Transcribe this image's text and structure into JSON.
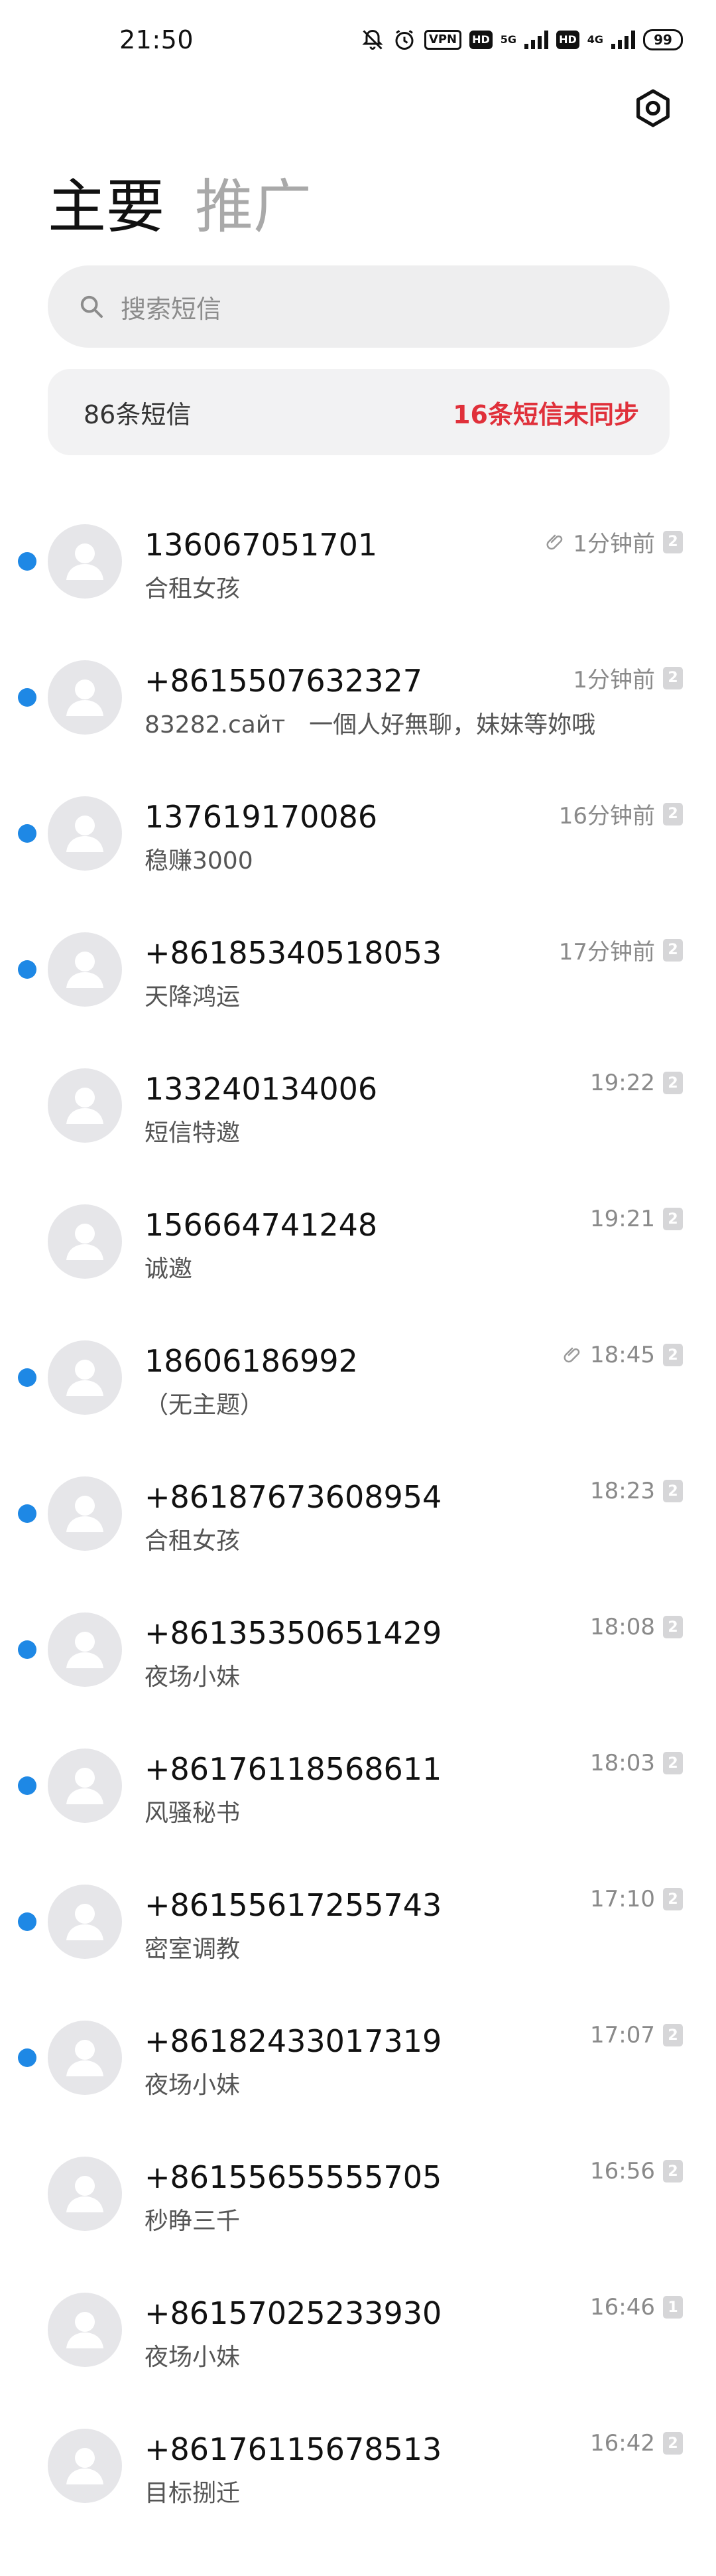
{
  "status_bar": {
    "time": "21:50",
    "vpn_label": "VPN",
    "hd_label_1": "HD",
    "net_1": "5G",
    "hd_label_2": "HD",
    "net_2": "4G",
    "battery": "99"
  },
  "tabs": [
    {
      "label": "主要",
      "active": true
    },
    {
      "label": "推广",
      "active": false
    }
  ],
  "search": {
    "placeholder": "搜索短信"
  },
  "summary": {
    "count_text": "86条短信",
    "unsynced_text": "16条短信未同步"
  },
  "colors": {
    "unread_dot": "#1e88e5",
    "unsynced": "#e0303a"
  },
  "messages": [
    {
      "sender": "136067051701",
      "preview": "合租女孩",
      "time": "1分钟前",
      "sim": "2",
      "unread": true,
      "attachment": true
    },
    {
      "sender": "+8615507632327",
      "preview": "83282.сайт　一個人好無聊，妹妹等妳哦",
      "time": "1分钟前",
      "sim": "2",
      "unread": true,
      "attachment": false
    },
    {
      "sender": "137619170086",
      "preview": "稳赚3000",
      "time": "16分钟前",
      "sim": "2",
      "unread": true,
      "attachment": false
    },
    {
      "sender": "+86185340518053",
      "preview": "天降鸿运",
      "time": "17分钟前",
      "sim": "2",
      "unread": true,
      "attachment": false
    },
    {
      "sender": "133240134006",
      "preview": "短信特邀",
      "time": "19:22",
      "sim": "2",
      "unread": false,
      "attachment": false
    },
    {
      "sender": "156664741248",
      "preview": "诚邀",
      "time": "19:21",
      "sim": "2",
      "unread": false,
      "attachment": false
    },
    {
      "sender": "18606186992",
      "preview": "（无主题）",
      "time": "18:45",
      "sim": "2",
      "unread": true,
      "attachment": true
    },
    {
      "sender": "+86187673608954",
      "preview": "合租女孩",
      "time": "18:23",
      "sim": "2",
      "unread": true,
      "attachment": false
    },
    {
      "sender": "+86135350651429",
      "preview": "夜场小妹",
      "time": "18:08",
      "sim": "2",
      "unread": true,
      "attachment": false
    },
    {
      "sender": "+86176118568611",
      "preview": "风骚秘书",
      "time": "18:03",
      "sim": "2",
      "unread": true,
      "attachment": false
    },
    {
      "sender": "+86155617255743",
      "preview": "密室调教",
      "time": "17:10",
      "sim": "2",
      "unread": true,
      "attachment": false
    },
    {
      "sender": "+86182433017319",
      "preview": "夜场小妹",
      "time": "17:07",
      "sim": "2",
      "unread": true,
      "attachment": false
    },
    {
      "sender": "+86155655555705",
      "preview": "秒睁三千",
      "time": "16:56",
      "sim": "2",
      "unread": false,
      "attachment": false
    },
    {
      "sender": "+86157025233930",
      "preview": "夜场小妹",
      "time": "16:46",
      "sim": "1",
      "unread": false,
      "attachment": false
    },
    {
      "sender": "+86176115678513",
      "preview": "目标捌迁",
      "time": "16:42",
      "sim": "2",
      "unread": false,
      "attachment": false
    }
  ]
}
